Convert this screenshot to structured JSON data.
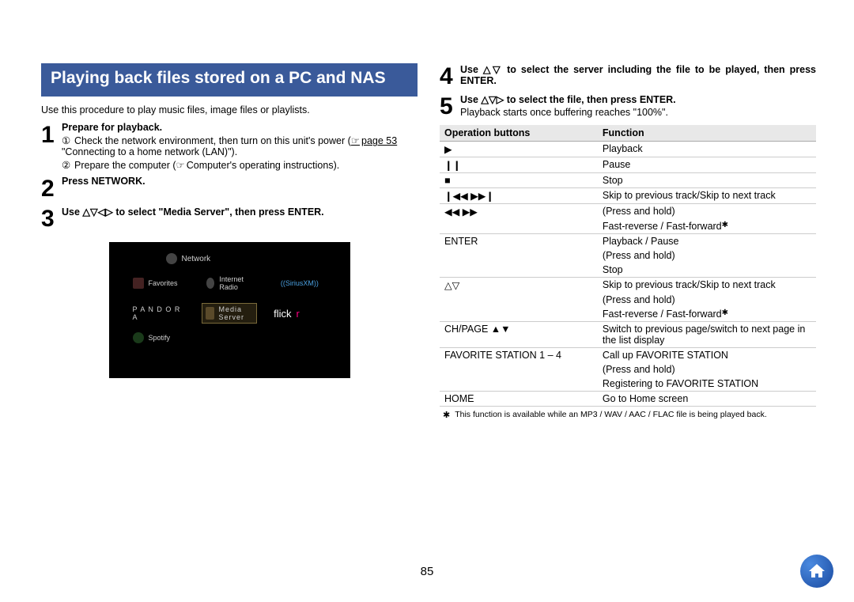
{
  "page_number": "85",
  "section_title": "Playing back files stored on a PC and NAS",
  "intro": "Use this procedure to play music files, image files or playlists.",
  "steps": {
    "s1": {
      "num": "1",
      "title": "Prepare for playback.",
      "sub1": "Check the network environment, then turn on this unit's power (",
      "sub1_link": "page 53",
      "sub1_after": " \"Connecting to a home network (LAN)\").",
      "sub2": "Prepare the computer (",
      "sub2_after": "Computer's operating instructions)."
    },
    "s2": {
      "num": "2",
      "title": "Press NETWORK."
    },
    "s3": {
      "num": "3",
      "title": "Use △▽◁▷ to select \"Media Server\", then press ENTER."
    },
    "s4": {
      "num": "4",
      "title": "Use △▽ to select the server including the file to be played, then press ENTER."
    },
    "s5": {
      "num": "5",
      "title": "Use △▽▷ to select the file, then press ENTER.",
      "note": "Playback starts once buffering reaches \"100%\"."
    }
  },
  "tv": {
    "header": "Network",
    "favorites": "Favorites",
    "internet_radio": "Internet Radio",
    "sirius": "((SiriusXM))",
    "pandora": "P A N D O R A",
    "media_server": "Media Server",
    "flickr_pre": "flick",
    "flickr_r": "r",
    "spotify": "Spotify"
  },
  "table": {
    "header_buttons": "Operation buttons",
    "header_function": "Function",
    "rows": [
      {
        "btn": "▶",
        "fn": "Playback",
        "sep": true
      },
      {
        "btn": "❙❙",
        "fn": "Pause",
        "sep": true
      },
      {
        "btn": "■",
        "fn": "Stop",
        "sep": true
      },
      {
        "btn": "❙◀◀  ▶▶❙",
        "fn": "Skip to previous track/Skip to next track",
        "sep": true
      },
      {
        "btn": "◀◀  ▶▶",
        "fn": "(Press and hold)",
        "sep": false
      },
      {
        "btn": "",
        "fn": "Fast-reverse / Fast-forward",
        "star": true,
        "sep": true
      },
      {
        "btn": "ENTER",
        "fn": "Playback / Pause",
        "sep": false
      },
      {
        "btn": "",
        "fn": "(Press and hold)",
        "sep": false
      },
      {
        "btn": "",
        "fn": "Stop",
        "sep": true
      },
      {
        "btn": "△▽",
        "fn": "Skip to previous track/Skip to next track",
        "sep": false
      },
      {
        "btn": "",
        "fn": "(Press and hold)",
        "sep": false
      },
      {
        "btn": "",
        "fn": "Fast-reverse / Fast-forward",
        "star": true,
        "sep": true
      },
      {
        "btn": "CH/PAGE ▲▼",
        "fn": "Switch to previous page/switch to next page in the list display",
        "sep": true
      },
      {
        "btn": "FAVORITE STATION 1 – 4",
        "fn": "Call up FAVORITE STATION",
        "sep": false
      },
      {
        "btn": "",
        "fn": "(Press and hold)",
        "sep": false
      },
      {
        "btn": "",
        "fn": "Registering to FAVORITE STATION",
        "sep": true
      },
      {
        "btn": "HOME",
        "fn": "Go to Home screen",
        "sep": true
      }
    ]
  },
  "footnote_marker": "✱",
  "footnote": "This function is available while an MP3 / WAV / AAC / FLAC file is being played back."
}
